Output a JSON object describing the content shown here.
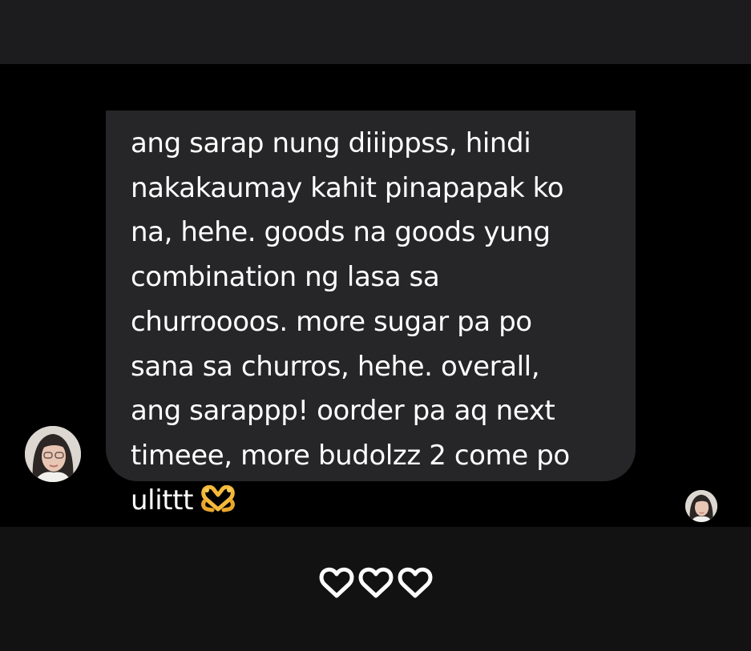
{
  "message": {
    "lines": [
      "ang sarap nung diiippss, hindi",
      "nakakaumay kahit pinapapak ko",
      "na, hehe. goods na goods yung",
      "combination ng lasa sa",
      "churroooos. more sugar pa po",
      "sana sa churros, hehe. overall,",
      "ang sarappp! oorder pa aq next",
      "timeee, more budolzz 2 come po",
      "ulittt"
    ],
    "emoji": "heart-hands-emoji"
  },
  "sender_avatar": {
    "icon": "avatar"
  },
  "seen_avatar": {
    "icon": "avatar"
  },
  "reactions": {
    "icons": [
      "heart-outline-icon",
      "heart-outline-icon",
      "heart-outline-icon"
    ]
  },
  "colors": {
    "background": "#000000",
    "top_bar": "#1c1c1e",
    "bubble": "#262628",
    "bottom_bar": "#121212",
    "text": "#ffffff"
  }
}
